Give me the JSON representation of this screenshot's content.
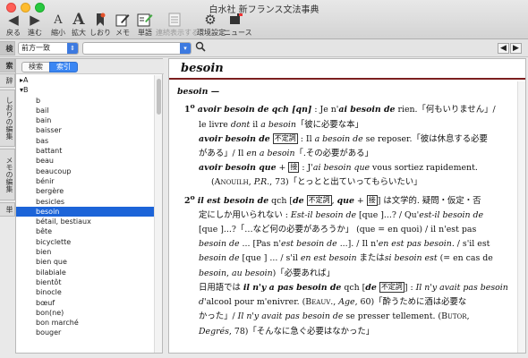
{
  "window": {
    "title": "白水社 新フランス文法事典"
  },
  "toolbar": {
    "back": {
      "label": "戻る",
      "icon": "back-arrow-icon"
    },
    "forward": {
      "label": "進む",
      "icon": "forward-arrow-icon"
    },
    "shrink": {
      "label": "縮小",
      "glyph": "A",
      "icon": "font-shrink-icon"
    },
    "enlarge": {
      "label": "拡大",
      "glyph": "A",
      "icon": "font-enlarge-icon"
    },
    "bookmark": {
      "label": "しおり",
      "icon": "bookmark-icon"
    },
    "memo": {
      "label": "メモ",
      "icon": "memo-icon"
    },
    "wordbook": {
      "label": "単語",
      "icon": "wordbook-icon"
    },
    "continuous": {
      "label": "連続表示する",
      "icon": "continuous-display-icon"
    },
    "settings": {
      "label": "環境設定",
      "icon": "gear-icon"
    },
    "news": {
      "label": "ニュース",
      "icon": "news-icon"
    }
  },
  "sidetabs": [
    "検",
    "索",
    "辞",
    "しおりの編集",
    "メモの編集",
    "単"
  ],
  "search": {
    "mode_value": "前方一致",
    "query_value": ""
  },
  "leftpanel": {
    "segments": [
      "検索",
      "索引"
    ],
    "active_segment": "索引",
    "groups": [
      {
        "label": "A",
        "expanded": false
      },
      {
        "label": "B",
        "expanded": true
      }
    ],
    "items": [
      "b",
      "bail",
      "bain",
      "baisser",
      "bas",
      "battant",
      "beau",
      "beaucoup",
      "bénir",
      "bergère",
      "besicles",
      "besoin",
      "bétail, bestiaux",
      "bête",
      "bicyclette",
      "bien",
      "bien que",
      "bilabiale",
      "bientôt",
      "binocle",
      "bœuf",
      "bon(ne)",
      "bon marché",
      "bouger"
    ],
    "selected": "besoin"
  },
  "entry": {
    "headword": "besoin",
    "lead": "besoin —",
    "s1_num": "1",
    "s1_sup": "o",
    "s1a_b": "avoir besoin de qch [qn]",
    "s1a_t1": " : Je n'",
    "s1a_i": "ai besoin de",
    "s1a_t2": " rien.「何もいりません」/",
    "s1b_t1": "le livre ",
    "s1b_i1": "dont",
    "s1b_t2": " il ",
    "s1b_i2": "a besoin",
    "s1b_t3": "「彼に必要な本」",
    "s1c_b": "avoir besoin de",
    "s1c_box": "不定詞",
    "s1c_t1": " : Il ",
    "s1c_i": "a besoin de",
    "s1c_t2": " se reposer.「彼は休息する必要",
    "s1d_t1": "がある」/ Il ",
    "s1d_i": "en a besoin",
    "s1d_t2": "「.その必要がある」",
    "s1e_b": "avoir besoin que",
    "s1e_plus": " + ",
    "s1e_box": "接",
    "s1e_t1": " : J'",
    "s1e_i": "ai besoin que",
    "s1e_t2": " vous sortiez rapidement.",
    "s1f_t1": "(",
    "s1f_name": "Anouilh",
    "s1f_t2": ", ",
    "s1f_work": "P.R.",
    "s1f_t3": ", 73)「とっとと出ていってもらいたい」",
    "s2_num": "2",
    "s2_sup": "o",
    "s2a_b1": "il est besoin de",
    "s2a_t0": " qch [",
    "s2a_b2": "de",
    "s2a_box1": "不定詞",
    "s2a_t1": ", ",
    "s2a_b3": "que",
    "s2a_plus": " + ",
    "s2a_box2": "接",
    "s2a_t2": "] は文学的. 疑問・仮定・否",
    "s2b_t1": "定にしか用いられない : ",
    "s2b_i1": "Est-il besoin de",
    "s2b_t2": " [que ]...? / Qu'",
    "s2b_i2": "est-il besoin de",
    "s2c_t1": "[que ]...?「…など何の必要があろうか」 (que = en quoi) / il n'est pas",
    "s2d_i1": "besoin de",
    "s2d_t1": " ... [Pas n'",
    "s2d_i2": "est besoin de",
    "s2d_t2": " ...]. / Il n'",
    "s2d_i3": "en est pas besoin",
    "s2d_t3": ". / s'il est",
    "s2e_i1": "besoin de",
    "s2e_t1": " [que ] ... / s'il ",
    "s2e_i2": "en est besoin",
    "s2e_t2": " または",
    "s2e_i3": "si besoin est",
    "s2e_t3": " (= en cas de",
    "s2f_i": "besoin",
    "s2f_t1": ", ",
    "s2f_i2": "au besoin",
    "s2f_t2": ")「必要あれば」",
    "s2g_t1": "日用語では ",
    "s2g_b1": "il n'y a pas besoin de",
    "s2g_t2": " qch [",
    "s2g_b2": "de",
    "s2g_box": "不定詞",
    "s2g_t3": "] : ",
    "s2g_i": "Il n'y avait pas besoin",
    "s2h_i": "d'",
    "s2h_t1": "alcool pour m'enivrer. (",
    "s2h_name": "Beauv.",
    "s2h_t2": ", ",
    "s2h_work": "Age",
    "s2h_t3": ", 60)「酔うために酒は必要な",
    "s2i_t1": "かった」/ ",
    "s2i_i": "Il n'y avait pas besoin de",
    "s2i_t2": " se presser tellement. (",
    "s2i_name": "Butor",
    "s2i_t3": ",",
    "s2j_work": "Degrés",
    "s2j_t1": ", 78)「そんなに急ぐ必要はなかった」"
  }
}
